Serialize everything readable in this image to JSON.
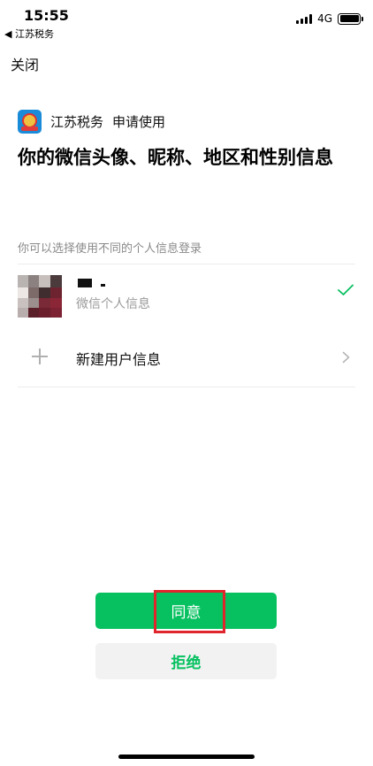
{
  "status_bar": {
    "time": "15:55",
    "back_app": "◀ 江苏税务",
    "network": "4G",
    "icons": [
      "cellular-signal-icon",
      "battery-icon"
    ]
  },
  "nav": {
    "close_label": "关闭"
  },
  "app": {
    "name": "江苏税务",
    "request": "申请使用",
    "logo_icon": "jiangsu-tax-logo"
  },
  "permission": {
    "title": "你的微信头像、昵称、地区和性别信息"
  },
  "accounts": {
    "hint": "你可以选择使用不同的个人信息登录",
    "profile": {
      "nickname": "",
      "subtitle": "微信个人信息",
      "selected": true
    },
    "new_user_label": "新建用户信息"
  },
  "buttons": {
    "agree": "同意",
    "reject": "拒绝"
  },
  "colors": {
    "primary_green": "#07c160",
    "highlight_red": "#e0252c",
    "secondary_bg": "#f2f2f2"
  }
}
